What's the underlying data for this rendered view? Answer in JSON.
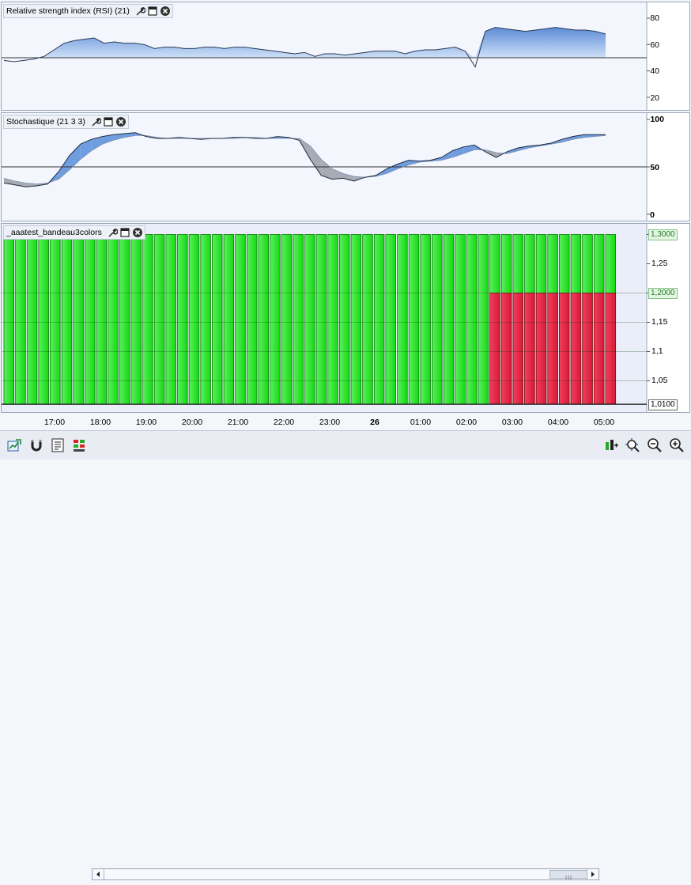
{
  "panes": {
    "rsi": {
      "title": "Relative strength index (RSI) (21)",
      "y_labels": [
        "80",
        "60",
        "40",
        "20"
      ]
    },
    "stoch": {
      "title": "Stochastique (21 3 3)",
      "y_labels": [
        "100",
        "50",
        "0"
      ]
    },
    "bandeau": {
      "title": "_aaatest_bandeau3colors",
      "y_labels": [
        "1,25",
        "1,15",
        "1,1",
        "1,05"
      ],
      "tag_top": "1,3000",
      "tag_mid": "1,2000",
      "tag_bottom": "1,0100"
    }
  },
  "x_axis": {
    "labels": [
      "17:00",
      "18:00",
      "19:00",
      "20:00",
      "21:00",
      "22:00",
      "23:00",
      "26",
      "01:00",
      "02:00",
      "03:00",
      "04:00",
      "05:00"
    ]
  },
  "colors": {
    "green": "#1ee81e",
    "red": "#e8243c",
    "rsi_fill": "#7fa7e0",
    "grey_fill": "#9aa0aa"
  },
  "icons": [
    "wrench-icon",
    "window-icon",
    "close-icon",
    "chart-export-icon",
    "magnet-icon",
    "list-icon",
    "levels-icon",
    "scroll-left-icon",
    "scroll-right-icon",
    "crosshair-icon",
    "zoom-fit-icon",
    "zoom-out-icon",
    "zoom-in-icon"
  ],
  "chart_data": [
    {
      "type": "area",
      "title": "Relative strength index (RSI) (21)",
      "ylim": [
        10,
        90
      ],
      "yticks": [
        20,
        40,
        60,
        80
      ],
      "reference_line": 50,
      "values": [
        48,
        47,
        48,
        49,
        51,
        56,
        61,
        63,
        64,
        65,
        61,
        62,
        61,
        61,
        60,
        57,
        58,
        58,
        57,
        57,
        58,
        58,
        57,
        58,
        58,
        57,
        56,
        55,
        54,
        53,
        54,
        51,
        53,
        53,
        52,
        53,
        54,
        55,
        55,
        55,
        53,
        55,
        56,
        56,
        57,
        58,
        55,
        43,
        70,
        73,
        72,
        71,
        70,
        71,
        72,
        73,
        72,
        71,
        71,
        70,
        68
      ]
    },
    {
      "type": "line",
      "title": "Stochastique (21 3 3)",
      "ylim": [
        0,
        100
      ],
      "yticks": [
        0,
        50,
        100
      ],
      "reference_line": 50,
      "series": [
        {
          "values": [
            33,
            31,
            29,
            30,
            32,
            45,
            62,
            74,
            79,
            82,
            84,
            85,
            86,
            82,
            80,
            80,
            81,
            80,
            79,
            80,
            80,
            81,
            81,
            80,
            80,
            82,
            81,
            78,
            58,
            41,
            37,
            38,
            35,
            39,
            41,
            48,
            53,
            57,
            56,
            57,
            60,
            67,
            71,
            73,
            66,
            60,
            66,
            70,
            72,
            73,
            75,
            79,
            82,
            84,
            84,
            84
          ]
        },
        {
          "values": [
            38,
            35,
            33,
            32,
            33,
            37,
            47,
            58,
            67,
            74,
            78,
            81,
            83,
            83,
            81,
            80,
            80,
            80,
            80,
            80,
            80,
            80,
            81,
            81,
            80,
            80,
            80,
            80,
            72,
            58,
            48,
            43,
            40,
            39,
            40,
            43,
            48,
            52,
            55,
            56,
            57,
            60,
            64,
            68,
            68,
            65,
            64,
            67,
            70,
            72,
            74,
            76,
            79,
            81,
            82,
            83
          ]
        }
      ]
    },
    {
      "type": "bar",
      "title": "_aaatest_bandeau3colors",
      "ylim": [
        1.0,
        1.32
      ],
      "yticks": [
        1.05,
        1.1,
        1.15,
        1.2,
        1.25,
        1.3
      ],
      "bar_count": 53,
      "series": [
        {
          "name": "",
          "color": "green",
          "values_top": 1.3,
          "values_bottom": 1.01
        },
        {
          "name": "",
          "color": "red",
          "from_bar": 42,
          "to_bar": 52,
          "values_top": 1.2,
          "values_bottom": 1.01
        }
      ]
    }
  ]
}
